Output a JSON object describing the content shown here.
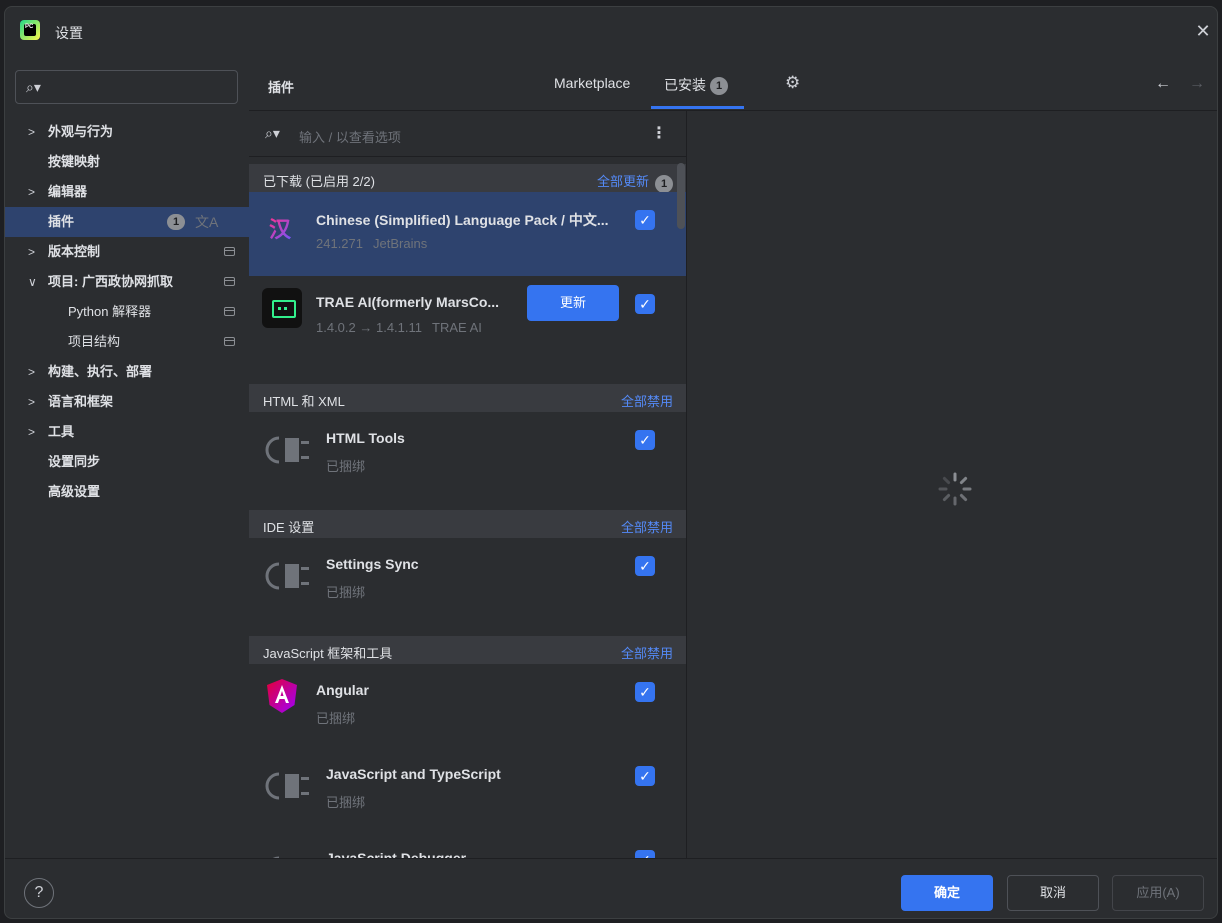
{
  "window": {
    "title": "设置",
    "logo_text": "PC"
  },
  "sidebar": {
    "items": [
      {
        "label": "外观与行为",
        "chevron": true
      },
      {
        "label": "按键映射",
        "chevron": false
      },
      {
        "label": "编辑器",
        "chevron": true
      },
      {
        "label": "插件",
        "chevron": false,
        "selected": true,
        "badge": "1"
      },
      {
        "label": "版本控制",
        "chevron": true
      },
      {
        "label": "项目: 广西政协网抓取",
        "chevron": true,
        "expanded": true
      },
      {
        "label": "Python 解释器",
        "sub": true
      },
      {
        "label": "项目结构",
        "sub": true
      },
      {
        "label": "构建、执行、部署",
        "chevron": true
      },
      {
        "label": "语言和框架",
        "chevron": true
      },
      {
        "label": "工具",
        "chevron": true
      },
      {
        "label": "设置同步",
        "chevron": false
      },
      {
        "label": "高级设置",
        "chevron": false
      }
    ]
  },
  "header": {
    "title": "插件",
    "tabs": {
      "marketplace": "Marketplace",
      "installed": "已安装",
      "installed_badge": "1"
    }
  },
  "plugin_search": {
    "placeholder": "输入 / 以查看选项"
  },
  "groups": {
    "downloaded": {
      "title": "已下载 (已启用 2/2)",
      "action": "全部更新",
      "badge": "1"
    },
    "html_xml": {
      "title": "HTML 和 XML",
      "action": "全部禁用"
    },
    "ide": {
      "title": "IDE 设置",
      "action": "全部禁用"
    },
    "js": {
      "title": "JavaScript 框架和工具",
      "action": "全部禁用"
    }
  },
  "plugins": {
    "chinese": {
      "name": "Chinese (Simplified) Language Pack / 中文...",
      "version": "241.271",
      "vendor": "JetBrains",
      "icon": "汉",
      "enabled": true
    },
    "trae": {
      "name": "TRAE AI(formerly MarsCo...",
      "version": "1.4.0.2 → 1.4.1.11",
      "vendor": "TRAE AI",
      "update_label": "更新",
      "enabled": true
    },
    "html_tools": {
      "name": "HTML Tools",
      "status": "已捆绑",
      "enabled": true
    },
    "settings_sync": {
      "name": "Settings Sync",
      "status": "已捆绑",
      "enabled": true
    },
    "angular": {
      "name": "Angular",
      "status": "已捆绑",
      "enabled": true
    },
    "js_ts": {
      "name": "JavaScript and TypeScript",
      "status": "已捆绑",
      "enabled": true
    },
    "js_debugger": {
      "name": "JavaScript Debugger",
      "enabled": true
    }
  },
  "footer": {
    "ok": "确定",
    "cancel": "取消",
    "apply": "应用(A)",
    "help": "?"
  },
  "colors": {
    "accent": "#3574f0",
    "selection": "#2e436e",
    "link": "#548af7"
  }
}
